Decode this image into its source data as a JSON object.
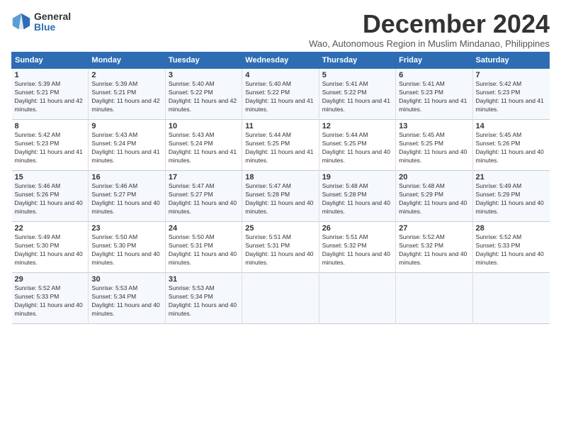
{
  "logo": {
    "general": "General",
    "blue": "Blue"
  },
  "title": "December 2024",
  "subtitle": "Wao, Autonomous Region in Muslim Mindanao, Philippines",
  "days_header": [
    "Sunday",
    "Monday",
    "Tuesday",
    "Wednesday",
    "Thursday",
    "Friday",
    "Saturday"
  ],
  "weeks": [
    [
      {
        "day": "1",
        "sunrise": "5:39 AM",
        "sunset": "5:21 PM",
        "daylight": "11 hours and 42 minutes."
      },
      {
        "day": "2",
        "sunrise": "5:39 AM",
        "sunset": "5:21 PM",
        "daylight": "11 hours and 42 minutes."
      },
      {
        "day": "3",
        "sunrise": "5:40 AM",
        "sunset": "5:22 PM",
        "daylight": "11 hours and 42 minutes."
      },
      {
        "day": "4",
        "sunrise": "5:40 AM",
        "sunset": "5:22 PM",
        "daylight": "11 hours and 41 minutes."
      },
      {
        "day": "5",
        "sunrise": "5:41 AM",
        "sunset": "5:22 PM",
        "daylight": "11 hours and 41 minutes."
      },
      {
        "day": "6",
        "sunrise": "5:41 AM",
        "sunset": "5:23 PM",
        "daylight": "11 hours and 41 minutes."
      },
      {
        "day": "7",
        "sunrise": "5:42 AM",
        "sunset": "5:23 PM",
        "daylight": "11 hours and 41 minutes."
      }
    ],
    [
      {
        "day": "8",
        "sunrise": "5:42 AM",
        "sunset": "5:23 PM",
        "daylight": "11 hours and 41 minutes."
      },
      {
        "day": "9",
        "sunrise": "5:43 AM",
        "sunset": "5:24 PM",
        "daylight": "11 hours and 41 minutes."
      },
      {
        "day": "10",
        "sunrise": "5:43 AM",
        "sunset": "5:24 PM",
        "daylight": "11 hours and 41 minutes."
      },
      {
        "day": "11",
        "sunrise": "5:44 AM",
        "sunset": "5:25 PM",
        "daylight": "11 hours and 41 minutes."
      },
      {
        "day": "12",
        "sunrise": "5:44 AM",
        "sunset": "5:25 PM",
        "daylight": "11 hours and 40 minutes."
      },
      {
        "day": "13",
        "sunrise": "5:45 AM",
        "sunset": "5:25 PM",
        "daylight": "11 hours and 40 minutes."
      },
      {
        "day": "14",
        "sunrise": "5:45 AM",
        "sunset": "5:26 PM",
        "daylight": "11 hours and 40 minutes."
      }
    ],
    [
      {
        "day": "15",
        "sunrise": "5:46 AM",
        "sunset": "5:26 PM",
        "daylight": "11 hours and 40 minutes."
      },
      {
        "day": "16",
        "sunrise": "5:46 AM",
        "sunset": "5:27 PM",
        "daylight": "11 hours and 40 minutes."
      },
      {
        "day": "17",
        "sunrise": "5:47 AM",
        "sunset": "5:27 PM",
        "daylight": "11 hours and 40 minutes."
      },
      {
        "day": "18",
        "sunrise": "5:47 AM",
        "sunset": "5:28 PM",
        "daylight": "11 hours and 40 minutes."
      },
      {
        "day": "19",
        "sunrise": "5:48 AM",
        "sunset": "5:28 PM",
        "daylight": "11 hours and 40 minutes."
      },
      {
        "day": "20",
        "sunrise": "5:48 AM",
        "sunset": "5:29 PM",
        "daylight": "11 hours and 40 minutes."
      },
      {
        "day": "21",
        "sunrise": "5:49 AM",
        "sunset": "5:29 PM",
        "daylight": "11 hours and 40 minutes."
      }
    ],
    [
      {
        "day": "22",
        "sunrise": "5:49 AM",
        "sunset": "5:30 PM",
        "daylight": "11 hours and 40 minutes."
      },
      {
        "day": "23",
        "sunrise": "5:50 AM",
        "sunset": "5:30 PM",
        "daylight": "11 hours and 40 minutes."
      },
      {
        "day": "24",
        "sunrise": "5:50 AM",
        "sunset": "5:31 PM",
        "daylight": "11 hours and 40 minutes."
      },
      {
        "day": "25",
        "sunrise": "5:51 AM",
        "sunset": "5:31 PM",
        "daylight": "11 hours and 40 minutes."
      },
      {
        "day": "26",
        "sunrise": "5:51 AM",
        "sunset": "5:32 PM",
        "daylight": "11 hours and 40 minutes."
      },
      {
        "day": "27",
        "sunrise": "5:52 AM",
        "sunset": "5:32 PM",
        "daylight": "11 hours and 40 minutes."
      },
      {
        "day": "28",
        "sunrise": "5:52 AM",
        "sunset": "5:33 PM",
        "daylight": "11 hours and 40 minutes."
      }
    ],
    [
      {
        "day": "29",
        "sunrise": "5:52 AM",
        "sunset": "5:33 PM",
        "daylight": "11 hours and 40 minutes."
      },
      {
        "day": "30",
        "sunrise": "5:53 AM",
        "sunset": "5:34 PM",
        "daylight": "11 hours and 40 minutes."
      },
      {
        "day": "31",
        "sunrise": "5:53 AM",
        "sunset": "5:34 PM",
        "daylight": "11 hours and 40 minutes."
      },
      {
        "day": "",
        "sunrise": "",
        "sunset": "",
        "daylight": ""
      },
      {
        "day": "",
        "sunrise": "",
        "sunset": "",
        "daylight": ""
      },
      {
        "day": "",
        "sunrise": "",
        "sunset": "",
        "daylight": ""
      },
      {
        "day": "",
        "sunrise": "",
        "sunset": "",
        "daylight": ""
      }
    ]
  ]
}
